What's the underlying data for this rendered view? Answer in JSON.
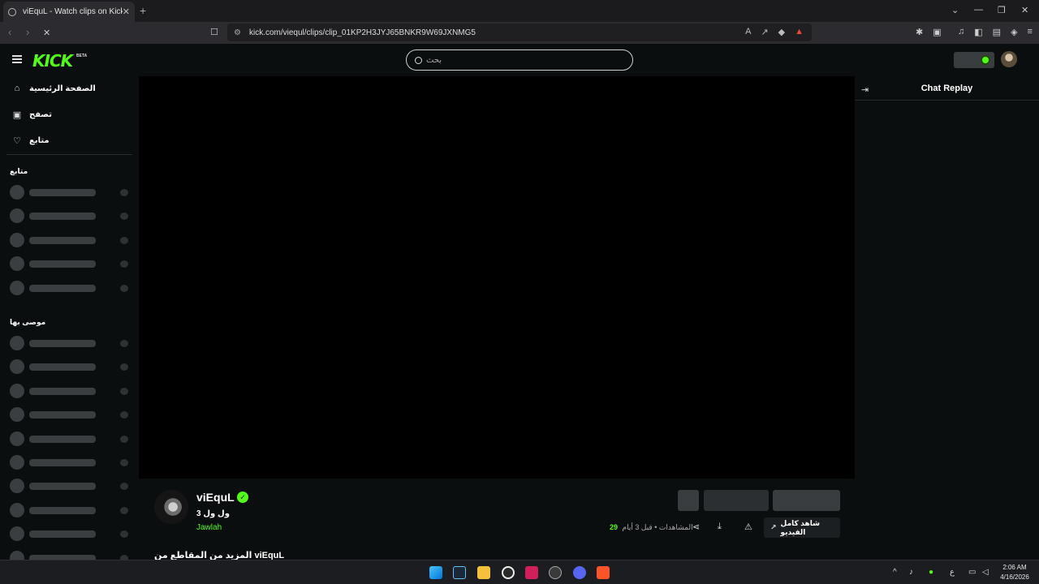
{
  "browser": {
    "tab_title": "viEquL - Watch clips on Kick",
    "tab_close": "✕",
    "new_tab": "+",
    "url": "kick.com/viequl/clips/clip_01KP2H3JYJ65BNKR9W69JXNMG5",
    "window_controls": {
      "chevron": "⌄",
      "minimize": "—",
      "restore": "❐",
      "close": "✕"
    },
    "nav_glyphs": {
      "back": "‹",
      "forward": "›",
      "stop": "✕",
      "bookmark": "⌂"
    }
  },
  "header": {
    "logo": "KICK",
    "logo_badge": "BETA",
    "search_placeholder": "بحث"
  },
  "sidebar": {
    "nav": [
      {
        "label": "الصفحة الرئيسية",
        "icon": "home-icon"
      },
      {
        "label": "تصفح",
        "icon": "browse-icon"
      },
      {
        "label": "متابع",
        "icon": "heart-icon"
      }
    ],
    "following_title": "متابع",
    "recommended_title": "موصى بها",
    "following_placeholders": 5,
    "recommended_placeholders": 10
  },
  "chat": {
    "title": "Chat Replay"
  },
  "clip": {
    "channel_name": "viEquL",
    "verified": true,
    "title": "ول ول 3",
    "category": "Jawlah",
    "views_count": "29",
    "views_label": "المشاهدات",
    "age": "قبل 3 أيام",
    "separator": "•",
    "watch_full_label": "شاهد كامل الفيديو",
    "more_from_label": "المزيد من المقاطع من viEquL"
  },
  "taskbar": {
    "time": "2:06 AM",
    "date": "4/16/2026",
    "lang": "ع",
    "tray_chevron": "^"
  },
  "colors": {
    "kick_green": "#53fc18",
    "page_bg": "#0b0e0f",
    "skeleton": "#3b3e40"
  }
}
